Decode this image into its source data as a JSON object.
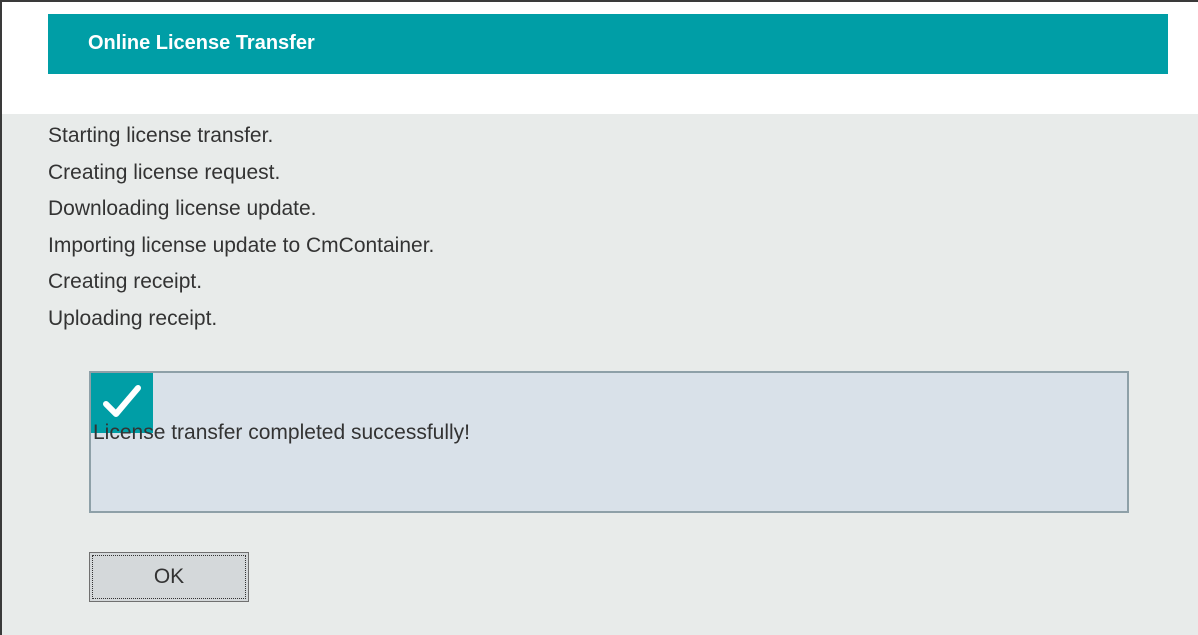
{
  "dialog": {
    "title": "Online License Transfer",
    "log_lines": [
      "Starting license transfer.",
      "Creating license request.",
      "Downloading license update.",
      "Importing license update to CmContainer.",
      "Creating receipt.",
      "Uploading receipt."
    ],
    "result": {
      "icon": "checkmark-icon",
      "message": "License transfer completed successfully!"
    },
    "ok_label": "OK"
  },
  "colors": {
    "accent": "#009ea6",
    "content_background": "#e8ebea",
    "result_panel_background": "#d9e1e9",
    "text": "#333333"
  }
}
